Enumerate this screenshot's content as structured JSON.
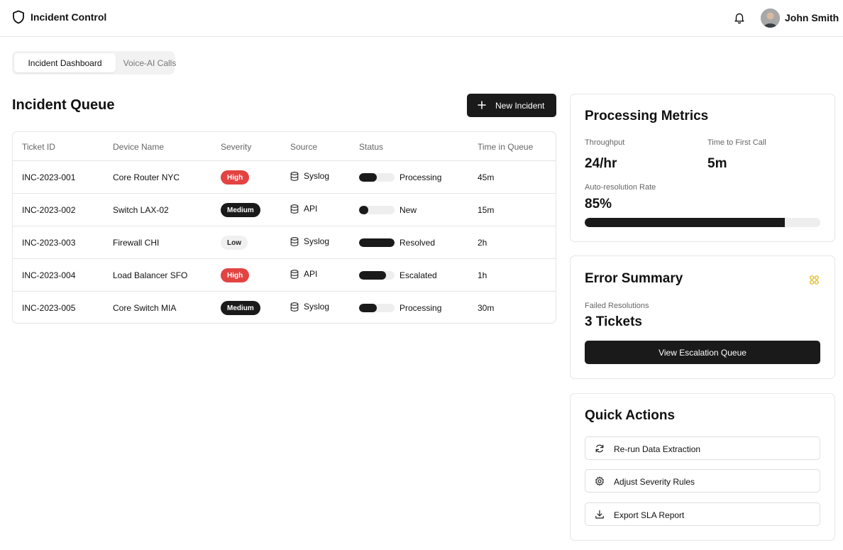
{
  "header": {
    "app_title": "Incident Control",
    "logo_icon": "shield-icon",
    "notification_icon": "bell-icon",
    "user_name": "John Smith"
  },
  "tabs": [
    {
      "label": "Incident Dashboard",
      "active": true
    },
    {
      "label": "Voice-AI Calls",
      "active": false
    }
  ],
  "queue": {
    "title": "Incident Queue",
    "new_button": "New Incident",
    "columns": [
      "Ticket ID",
      "Device Name",
      "Severity",
      "Source",
      "Status",
      "Time in Queue"
    ],
    "rows": [
      {
        "ticket_id": "INC-2023-001",
        "device": "Core Router NYC",
        "severity": "High",
        "source": "Syslog",
        "status": "Processing",
        "progress": 0.5,
        "time": "45m"
      },
      {
        "ticket_id": "INC-2023-002",
        "device": "Switch LAX-02",
        "severity": "Medium",
        "source": "API",
        "status": "New",
        "progress": 0.25,
        "time": "15m"
      },
      {
        "ticket_id": "INC-2023-003",
        "device": "Firewall CHI",
        "severity": "Low",
        "source": "Syslog",
        "status": "Resolved",
        "progress": 1.0,
        "time": "2h"
      },
      {
        "ticket_id": "INC-2023-004",
        "device": "Load Balancer SFO",
        "severity": "High",
        "source": "API",
        "status": "Escalated",
        "progress": 0.75,
        "time": "1h"
      },
      {
        "ticket_id": "INC-2023-005",
        "device": "Core Switch MIA",
        "severity": "Medium",
        "source": "Syslog",
        "status": "Processing",
        "progress": 0.5,
        "time": "30m"
      }
    ]
  },
  "metrics": {
    "title": "Processing Metrics",
    "throughput_label": "Throughput",
    "throughput_value": "24/hr",
    "first_call_label": "Time to First Call",
    "first_call_value": "5m",
    "auto_label": "Auto-resolution Rate",
    "auto_value": "85%",
    "auto_fraction": 0.85
  },
  "errors": {
    "title": "Error Summary",
    "failed_label": "Failed Resolutions",
    "failed_value": "3 Tickets",
    "button": "View Escalation Queue",
    "icon": "grid-icon",
    "icon_color": "#e0b000"
  },
  "quick_actions": {
    "title": "Quick Actions",
    "items": [
      {
        "label": "Re-run Data Extraction",
        "icon": "refresh-icon"
      },
      {
        "label": "Adjust Severity Rules",
        "icon": "gear-icon"
      },
      {
        "label": "Export SLA Report",
        "icon": "download-icon"
      }
    ]
  },
  "colors": {
    "accent_dark": "#1a1a1a",
    "high": "#e34343",
    "low_bg": "#f0f0f0"
  }
}
